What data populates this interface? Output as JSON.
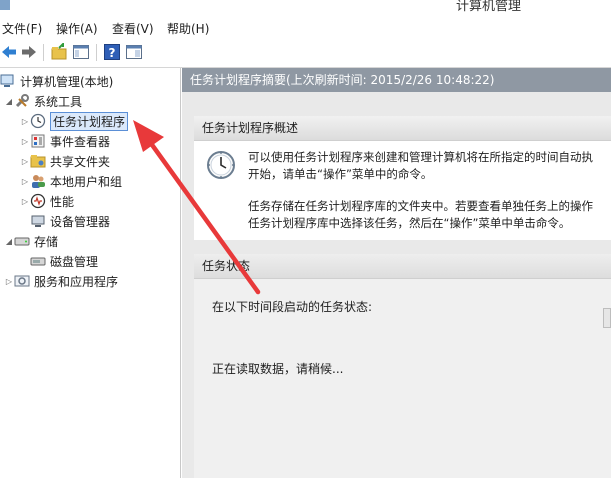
{
  "window": {
    "title": "计算机管理"
  },
  "menu": [
    "文件(F)",
    "操作(A)",
    "查看(V)",
    "帮助(H)"
  ],
  "toolbar": {
    "icons": [
      "back-icon",
      "forward-icon",
      "up-folder-icon",
      "show-hide-tree-icon",
      "help-icon",
      "console-tree-icon"
    ]
  },
  "tree": {
    "root": "计算机管理(本地)",
    "system_tools": "系统工具",
    "items": [
      "任务计划程序",
      "事件查看器",
      "共享文件夹",
      "本地用户和组",
      "性能",
      "设备管理器"
    ],
    "storage": "存储",
    "disk_management": "磁盘管理",
    "services_apps": "服务和应用程序"
  },
  "summary": {
    "header": "任务计划程序摘要(上次刷新时间: 2015/2/26 10:48:22)"
  },
  "overview": {
    "title": "任务计划程序概述",
    "line1": "可以使用任务计划程序来创建和管理计算机将在所指定的时间自动执",
    "line2": "开始，请单击“操作”菜单中的命令。",
    "line3": "任务存储在任务计划程序库的文件夹中。若要查看单独任务上的操作",
    "line4": "任务计划程序库中选择该任务，然后在“操作”菜单中单击命令。"
  },
  "status": {
    "title": "任务状态",
    "tasks_started_label": "在以下时间段启动的任务状态:",
    "loading_text": "正在读取数据，请稍候..."
  },
  "colors": {
    "accent_red": "#e8393a",
    "header_gray": "#8f98a3",
    "selection_blue": "#dbe9fb"
  }
}
